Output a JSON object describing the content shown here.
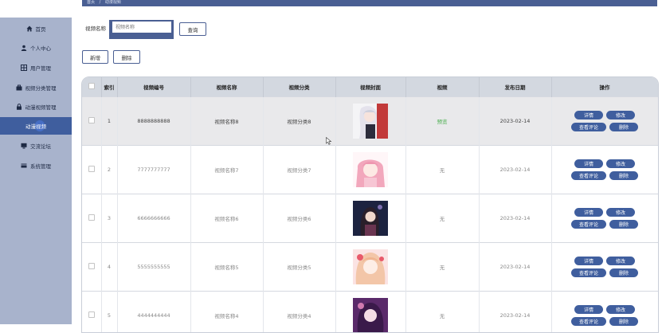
{
  "breadcrumb": {
    "home": "首页",
    "sep": "/",
    "current": "动漫视频"
  },
  "sidebar": {
    "items": [
      {
        "label": "首页",
        "icon": "home-icon"
      },
      {
        "label": "个人中心",
        "icon": "user-icon"
      },
      {
        "label": "用户管理",
        "icon": "grid-icon"
      },
      {
        "label": "视频分类管理",
        "icon": "briefcase-icon"
      },
      {
        "label": "动漫视频管理",
        "icon": "lock-icon"
      },
      {
        "label": "动漫视频",
        "icon": ""
      },
      {
        "label": "交流论坛",
        "icon": "monitor-icon"
      },
      {
        "label": "系统管理",
        "icon": "card-icon"
      }
    ],
    "active_index": 5
  },
  "search": {
    "label": "视频名称",
    "placeholder": "视频名称",
    "button": "查询"
  },
  "actions": {
    "add": "新增",
    "delete": "删除"
  },
  "table": {
    "headers": [
      "",
      "索引",
      "视频编号",
      "视频名称",
      "视频分类",
      "视频封面",
      "视频",
      "发布日期",
      "操作"
    ],
    "rows": [
      {
        "index": "1",
        "code": "8888888888",
        "name": "视频名称8",
        "category": "视频分类8",
        "video": "预览",
        "date": "2023-02-14"
      },
      {
        "index": "2",
        "code": "7777777777",
        "name": "视频名称7",
        "category": "视频分类7",
        "video": "无",
        "date": "2023-02-14"
      },
      {
        "index": "3",
        "code": "6666666666",
        "name": "视频名称6",
        "category": "视频分类6",
        "video": "无",
        "date": "2023-02-14"
      },
      {
        "index": "4",
        "code": "5555555555",
        "name": "视频名称5",
        "category": "视频分类5",
        "video": "无",
        "date": "2023-02-14"
      },
      {
        "index": "5",
        "code": "4444444444",
        "name": "视频名称4",
        "category": "视频分类4",
        "video": "无",
        "date": "2023-02-14"
      }
    ],
    "row_buttons": {
      "detail": "详情",
      "edit": "修改",
      "comments": "查看评论",
      "delete": "删除"
    }
  },
  "colors": {
    "accent": "#3f5e9e",
    "sidebar_bg": "#a8b3cc",
    "preview_link": "#4caf50"
  }
}
